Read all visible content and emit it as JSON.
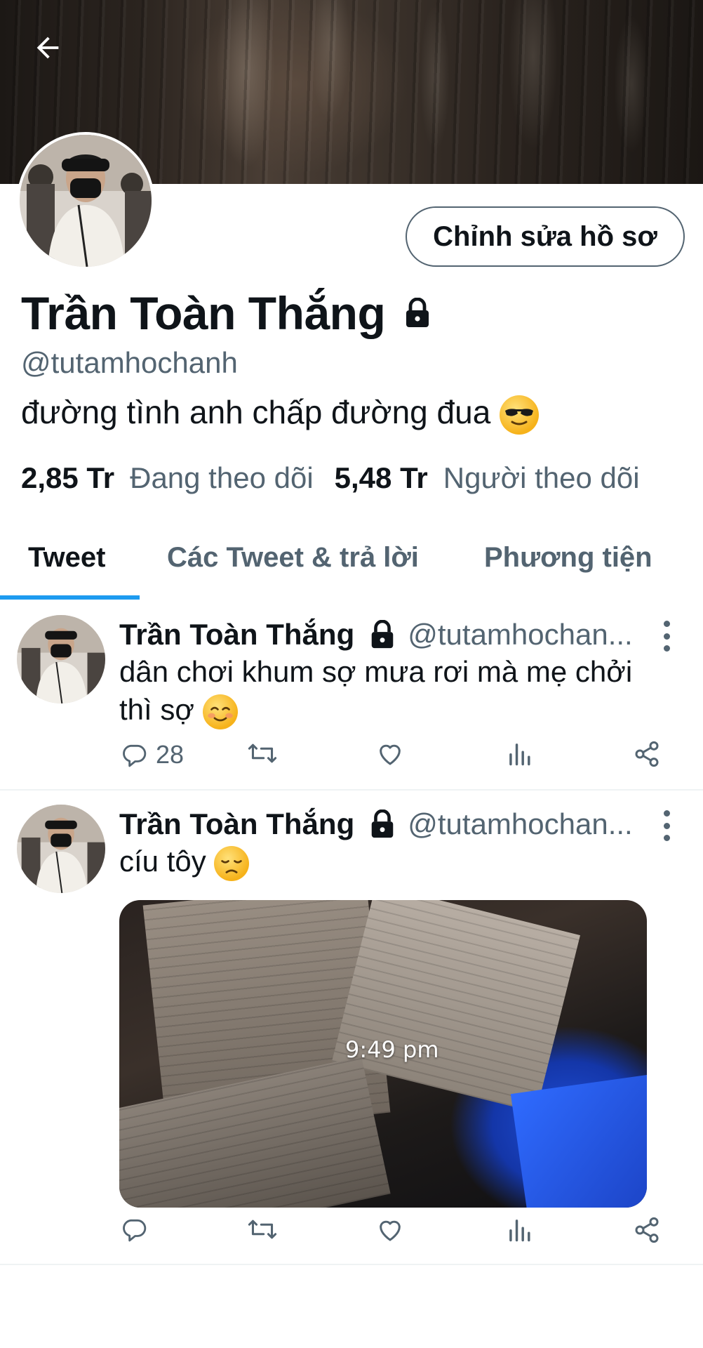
{
  "header": {
    "back_label": "Back"
  },
  "profile": {
    "edit_button": "Chỉnh sửa hồ sơ",
    "name": "Trần Toàn Thắng",
    "handle": "@tutamhochanh",
    "bio": "đường tình anh chấp đường đua",
    "bio_emoji": "smiling-face-with-sunglasses",
    "following_count": "2,85 Tr",
    "following_label": "Đang theo dõi",
    "followers_count": "5,48 Tr",
    "followers_label": "Người theo dõi"
  },
  "tabs": [
    "Tweet",
    "Các Tweet & trả lời",
    "Phương tiện"
  ],
  "tweets": [
    {
      "name": "Trần Toàn Thắng",
      "handle": "@tutamhochan...",
      "text": "dân chơi khum sợ mưa rơi mà mẹ chởi thì sợ",
      "emoji": "smiling-face",
      "reply_count": "28"
    },
    {
      "name": "Trần Toàn Thắng",
      "handle": "@tutamhochan...",
      "text": "cíu tôy",
      "emoji": "disappointed-face",
      "media_time": "9:49 pm",
      "reply_count": ""
    }
  ],
  "colors": {
    "accent": "#1d9bf0",
    "secondary_text": "#536471",
    "primary_text": "#0f1419"
  }
}
